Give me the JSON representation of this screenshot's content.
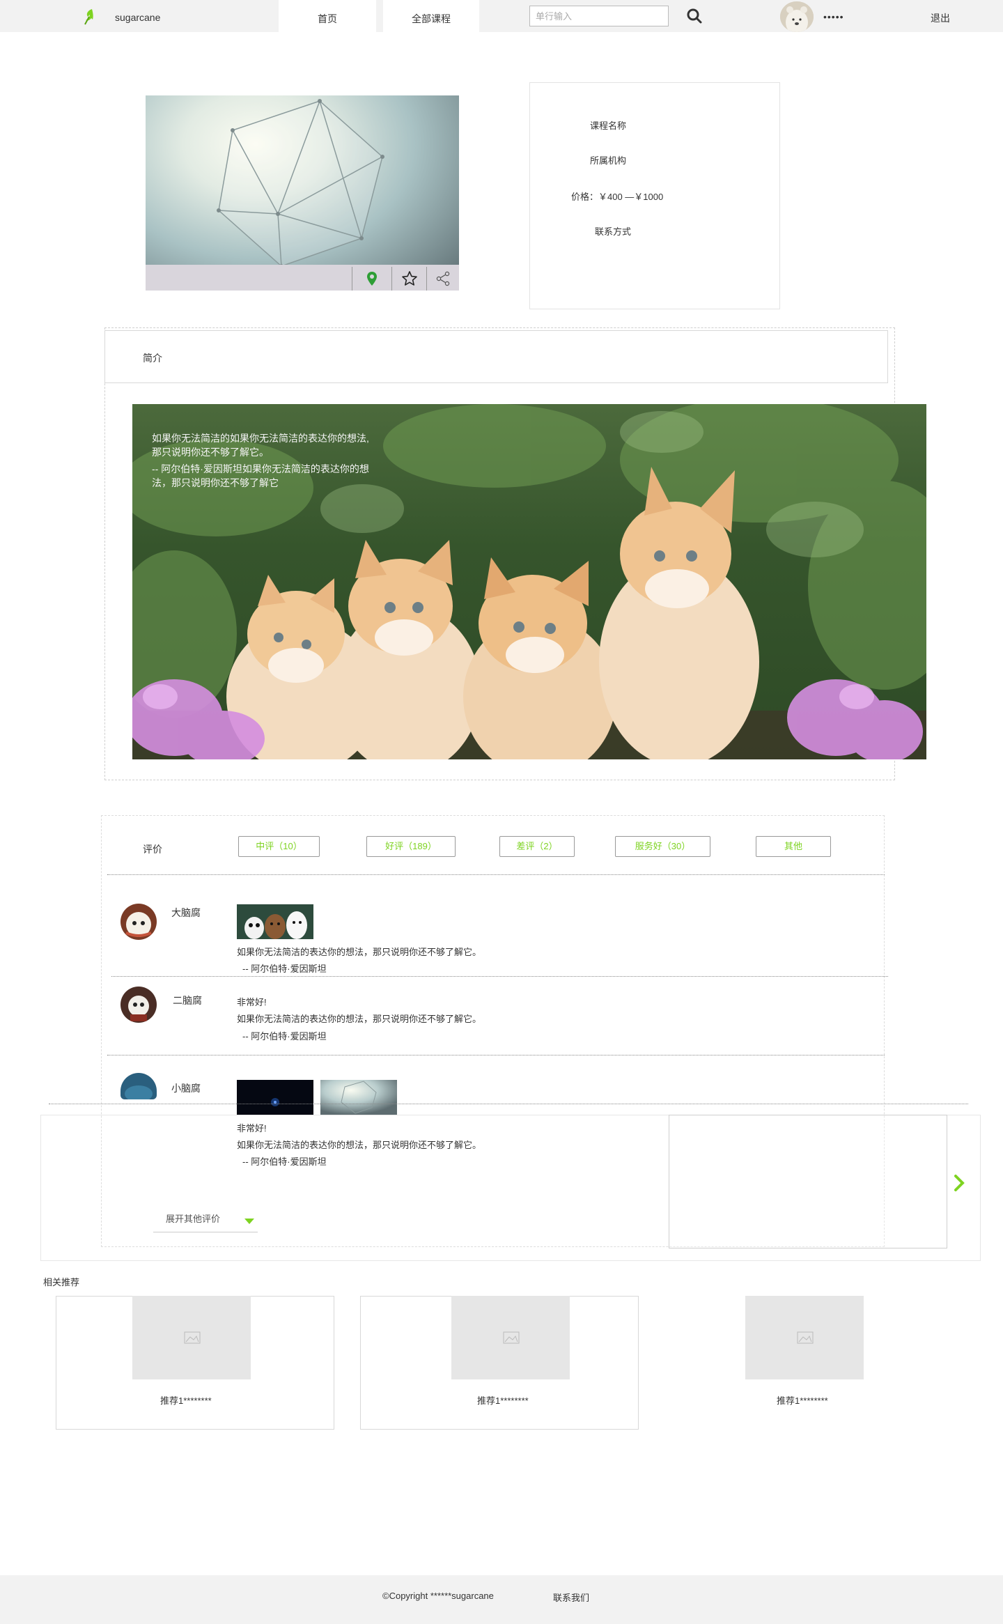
{
  "header": {
    "brand": "sugarcane",
    "tabs": [
      "首页",
      "全部课程"
    ],
    "search_placeholder": "单行输入",
    "username": "•••••",
    "logout": "退出"
  },
  "course": {
    "name": "课程名称",
    "organization": "所属机构",
    "price": "价格：￥400 —￥1000",
    "contact": "联系方式"
  },
  "intro": {
    "title": "简介",
    "quote_lines": [
      "如果你无法简洁的如果你无法简洁的表达你的想法,",
      "那只说明你还不够了解它。",
      "-- 阿尔伯特·爱因斯坦如果你无法简洁的表达你的想",
      "法，那只说明你还不够了解它"
    ]
  },
  "reviews": {
    "title": "评价",
    "filters": [
      "中评（10）",
      "好评（189）",
      "差评（2）",
      "服务好（30）",
      "其他"
    ],
    "items": [
      {
        "name": "大脑腐",
        "lines": [
          "如果你无法简洁的表达你的想法，那只说明你还不够了解它。",
          "-- 阿尔伯特·爱因斯坦"
        ]
      },
      {
        "name": "二脑腐",
        "lines": [
          "非常好!",
          "如果你无法简洁的表达你的想法，那只说明你还不够了解它。",
          "-- 阿尔伯特·爱因斯坦"
        ]
      },
      {
        "name": "小脑腐",
        "lines": [
          "非常好!",
          "如果你无法简洁的表达你的想法，那只说明你还不够了解它。",
          "-- 阿尔伯特·爱因斯坦"
        ]
      }
    ],
    "expand_label": "展开其他评价"
  },
  "related": {
    "title": "相关推荐",
    "items": [
      "推荐1********",
      "推荐1********",
      "推荐1********"
    ]
  },
  "footer": {
    "copyright": "©Copyright ******sugarcane",
    "contact": "联系我们"
  },
  "colors": {
    "accent": "#7ed321",
    "header_bg": "#f2f2f2",
    "footer_bg": "#f2f2f2"
  },
  "icons": [
    "leaf-logo-icon",
    "search-icon",
    "location-pin-icon",
    "star-icon",
    "share-icon",
    "chevron-down-icon",
    "chevron-right-icon",
    "image-placeholder-icon"
  ]
}
